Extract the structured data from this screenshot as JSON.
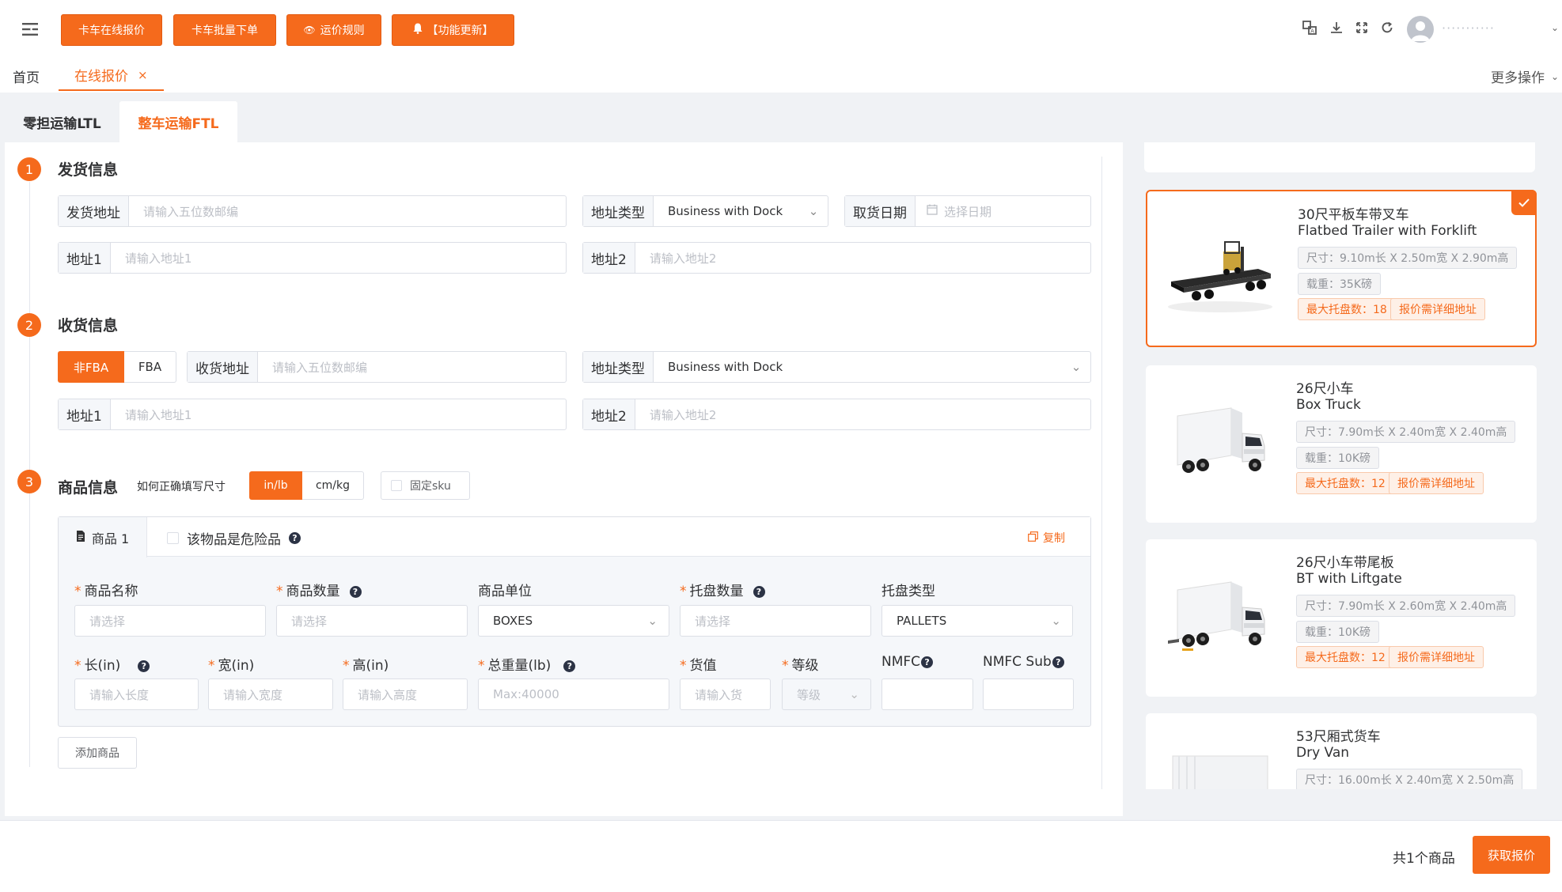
{
  "header": {
    "buttons": [
      "卡车在线报价",
      "卡车批量下单",
      "运价规则",
      "【功能更新】"
    ],
    "user_masked": "···········"
  },
  "tabs": {
    "home": "首页",
    "active": "在线报价",
    "close": "×",
    "more": "更多操作"
  },
  "mode_tabs": [
    "零担运输LTL",
    "整车运输FTL"
  ],
  "shipper": {
    "num": "1",
    "title": "发货信息",
    "address_label": "发货地址",
    "address_placeholder": "请输入五位数邮编",
    "type_label": "地址类型",
    "type_value": "Business with Dock",
    "date_label": "取货日期",
    "date_placeholder": "选择日期",
    "addr1_label": "地址1",
    "addr1_placeholder": "请输入地址1",
    "addr2_label": "地址2",
    "addr2_placeholder": "请输入地址2"
  },
  "receiver": {
    "num": "2",
    "title": "收货信息",
    "toggle": [
      "非FBA",
      "FBA"
    ],
    "address_label": "收货地址",
    "address_placeholder": "请输入五位数邮编",
    "type_label": "地址类型",
    "type_value": "Business with Dock",
    "addr1_label": "地址1",
    "addr1_placeholder": "请输入地址1",
    "addr2_label": "地址2",
    "addr2_placeholder": "请输入地址2"
  },
  "goods": {
    "num": "3",
    "title": "商品信息",
    "hint": "如何正确填写尺寸",
    "units": [
      "in/lb",
      "cm/kg"
    ],
    "fixed_sku": "固定sku",
    "item_tab": "商品 1",
    "dangerous": "该物品是危险品",
    "copy": "复制",
    "labels": {
      "name": "商品名称",
      "qty": "商品数量",
      "unit": "商品单位",
      "pallet_qty": "托盘数量",
      "pallet_type": "托盘类型",
      "length": "长(in)",
      "width": "宽(in)",
      "height": "高(in)",
      "weight": "总重量(lb)",
      "value": "货值",
      "grade": "等级",
      "nmfc": "NMFC",
      "nmfc_sub": "NMFC Sub"
    },
    "placeholders": {
      "name": "请选择",
      "qty": "请选择",
      "pallet_qty": "请选择",
      "length": "请输入长度",
      "width": "请输入宽度",
      "height": "请输入高度",
      "weight": "Max:40000",
      "value": "请输入货",
      "grade": "等级"
    },
    "values": {
      "unit": "BOXES",
      "pallet_type": "PALLETS"
    },
    "add_button": "添加商品"
  },
  "trucks": [
    {
      "cn": "30尺平板车带叉车",
      "en": "Flatbed Trailer with Forklift",
      "size": "尺寸：9.10m长 X 2.50m宽 X 2.90m高",
      "load": "载重：35K磅",
      "pallets": "最大托盘数：18",
      "note": "报价需详细地址",
      "selected": true
    },
    {
      "cn": "26尺小车",
      "en": "Box Truck",
      "size": "尺寸：7.90m长 X 2.40m宽 X 2.40m高",
      "load": "载重：10K磅",
      "pallets": "最大托盘数：12",
      "note": "报价需详细地址",
      "selected": false
    },
    {
      "cn": "26尺小车带尾板",
      "en": "BT with Liftgate",
      "size": "尺寸：7.90m长 X 2.60m宽 X 2.40m高",
      "load": "载重：10K磅",
      "pallets": "最大托盘数：12",
      "note": "报价需详细地址",
      "selected": false
    },
    {
      "cn": "53尺厢式货车",
      "en": "Dry Van",
      "size": "尺寸：16.00m长 X 2.40m宽 X 2.50m高",
      "selected": false
    }
  ],
  "footer": {
    "count": "共1个商品",
    "submit": "获取报价"
  },
  "colors": {
    "accent": "#f56a1c",
    "panel_bg": "#f0f2f5"
  }
}
